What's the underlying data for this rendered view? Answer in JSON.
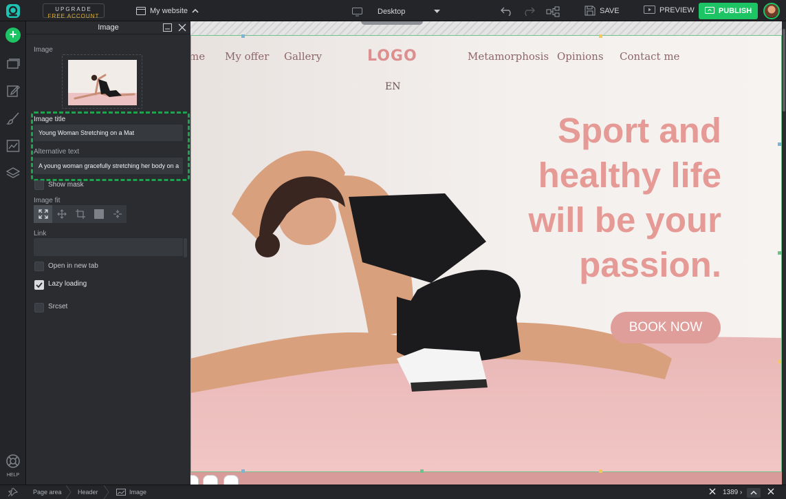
{
  "topbar": {
    "upgrade_line1": "UPGRADE",
    "upgrade_line2": "FREE ACCOUNT",
    "site_name": "My website",
    "device": "Desktop",
    "save": "SAVE",
    "preview": "PREVIEW",
    "publish": "PUBLISH"
  },
  "left_rail": {
    "help": "HELP"
  },
  "panel": {
    "title": "Image",
    "image_label": "Image",
    "image_title_label": "Image title",
    "image_title_value": "Young Woman Stretching on a Mat",
    "alt_text_label": "Alternative text",
    "alt_text_value": "A young woman gracefully stretching her body on a",
    "show_mask": "Show mask",
    "image_fit_label": "Image fit",
    "link_label": "Link",
    "open_new_tab": "Open in new tab",
    "lazy_loading": "Lazy loading",
    "srcset": "Srcset"
  },
  "site": {
    "nav": [
      "me",
      "My offer",
      "Gallery",
      "Metamorphosis",
      "Opinions",
      "Contact me"
    ],
    "logo": "LOGO",
    "lang": "EN",
    "headline_lines": [
      "Sport and",
      "healthy life",
      "will be your",
      "passion."
    ],
    "cta": "BOOK NOW"
  },
  "statusbar": {
    "crumbs": [
      "Page area",
      "Header",
      "Image"
    ],
    "width": "1389 ›"
  },
  "colors": {
    "accent": "#1dc464",
    "headline": "#e59a96",
    "cta": "#e09e9b",
    "highlight": "#1aa64c"
  }
}
